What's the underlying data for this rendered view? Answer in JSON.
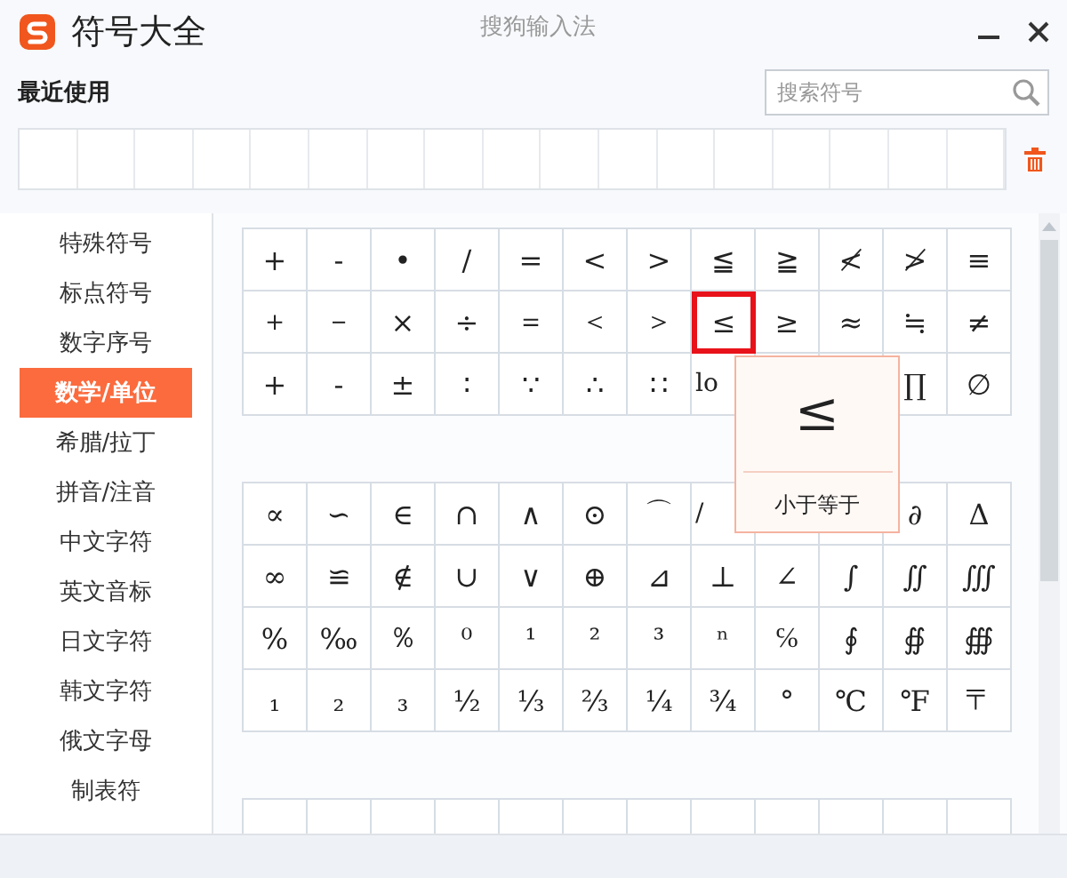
{
  "window": {
    "title": "符号大全",
    "subtitle": "搜狗输入法"
  },
  "recent": {
    "label": "最近使用"
  },
  "search": {
    "placeholder": "搜索符号"
  },
  "sidebar": {
    "items": [
      {
        "label": "特殊符号",
        "selected": false
      },
      {
        "label": "标点符号",
        "selected": false
      },
      {
        "label": "数字序号",
        "selected": false
      },
      {
        "label": "数学/单位",
        "selected": true
      },
      {
        "label": "希腊/拉丁",
        "selected": false
      },
      {
        "label": "拼音/注音",
        "selected": false
      },
      {
        "label": "中文字符",
        "selected": false
      },
      {
        "label": "英文音标",
        "selected": false
      },
      {
        "label": "日文字符",
        "selected": false
      },
      {
        "label": "韩文字符",
        "selected": false
      },
      {
        "label": "俄文字母",
        "selected": false
      },
      {
        "label": "制表符",
        "selected": false
      }
    ]
  },
  "groups": [
    {
      "rows": [
        [
          {
            "s": "+",
            "selected": false
          },
          {
            "s": "-",
            "selected": false
          },
          {
            "s": "•",
            "selected": false
          },
          {
            "s": "/",
            "selected": false
          },
          {
            "s": "=",
            "selected": false
          },
          {
            "s": "<",
            "selected": false
          },
          {
            "s": ">",
            "selected": false
          },
          {
            "s": "≦",
            "selected": false
          },
          {
            "s": "≧",
            "selected": false
          },
          {
            "s": "≮",
            "selected": false
          },
          {
            "s": "≯",
            "selected": false
          },
          {
            "s": "≡",
            "selected": false
          }
        ],
        [
          {
            "s": "＋",
            "selected": false
          },
          {
            "s": "－",
            "selected": false
          },
          {
            "s": "×",
            "selected": false
          },
          {
            "s": "÷",
            "selected": false
          },
          {
            "s": "＝",
            "selected": false
          },
          {
            "s": "＜",
            "selected": false
          },
          {
            "s": "＞",
            "selected": false
          },
          {
            "s": "≤",
            "selected": true
          },
          {
            "s": "≥",
            "selected": false
          },
          {
            "s": "≈",
            "selected": false
          },
          {
            "s": "≒",
            "selected": false
          },
          {
            "s": "≠",
            "selected": false
          }
        ],
        [
          {
            "s": "+",
            "selected": false
          },
          {
            "s": "-",
            "selected": false
          },
          {
            "s": "±",
            "selected": false
          },
          {
            "s": "∶",
            "selected": false
          },
          {
            "s": "∵",
            "selected": false
          },
          {
            "s": "∴",
            "selected": false
          },
          {
            "s": "∷",
            "selected": false
          },
          {
            "s": "lo",
            "selected": false
          },
          null,
          null,
          {
            "s": "∏",
            "selected": false
          },
          {
            "s": "∅",
            "selected": false
          }
        ]
      ]
    },
    {
      "rows": [
        [
          {
            "s": "∝",
            "selected": false
          },
          {
            "s": "∽",
            "selected": false
          },
          {
            "s": "∈",
            "selected": false
          },
          {
            "s": "∩",
            "selected": false
          },
          {
            "s": "∧",
            "selected": false
          },
          {
            "s": "⊙",
            "selected": false
          },
          {
            "s": "⌒",
            "selected": false
          },
          {
            "s": "/",
            "selected": false
          },
          null,
          null,
          {
            "s": "∂",
            "selected": false
          },
          {
            "s": "Δ",
            "selected": false
          }
        ],
        [
          {
            "s": "∞",
            "selected": false
          },
          {
            "s": "≌",
            "selected": false
          },
          {
            "s": "∉",
            "selected": false
          },
          {
            "s": "∪",
            "selected": false
          },
          {
            "s": "∨",
            "selected": false
          },
          {
            "s": "⊕",
            "selected": false
          },
          {
            "s": "⊿",
            "selected": false
          },
          {
            "s": "⊥",
            "selected": false
          },
          {
            "s": "∠",
            "selected": false
          },
          {
            "s": "∫",
            "selected": false
          },
          {
            "s": "∬",
            "selected": false
          },
          {
            "s": "∭",
            "selected": false
          }
        ],
        [
          {
            "s": "%",
            "selected": false
          },
          {
            "s": "‰",
            "selected": false
          },
          {
            "s": "％",
            "selected": false
          },
          {
            "s": "⁰",
            "selected": false
          },
          {
            "s": "¹",
            "selected": false
          },
          {
            "s": "²",
            "selected": false
          },
          {
            "s": "³",
            "selected": false
          },
          {
            "s": "ⁿ",
            "selected": false
          },
          {
            "s": "℅",
            "selected": false
          },
          {
            "s": "∮",
            "selected": false
          },
          {
            "s": "∯",
            "selected": false
          },
          {
            "s": "∰",
            "selected": false
          }
        ],
        [
          {
            "s": "₁",
            "selected": false
          },
          {
            "s": "₂",
            "selected": false
          },
          {
            "s": "₃",
            "selected": false
          },
          {
            "s": "½",
            "selected": false
          },
          {
            "s": "⅓",
            "selected": false
          },
          {
            "s": "⅔",
            "selected": false
          },
          {
            "s": "¼",
            "selected": false
          },
          {
            "s": "¾",
            "selected": false
          },
          {
            "s": "°",
            "selected": false
          },
          {
            "s": "℃",
            "selected": false
          },
          {
            "s": "℉",
            "selected": false
          },
          {
            "s": "〒",
            "selected": false
          }
        ]
      ]
    }
  ],
  "tooltip": {
    "symbol": "≤",
    "name": "小于等于"
  }
}
